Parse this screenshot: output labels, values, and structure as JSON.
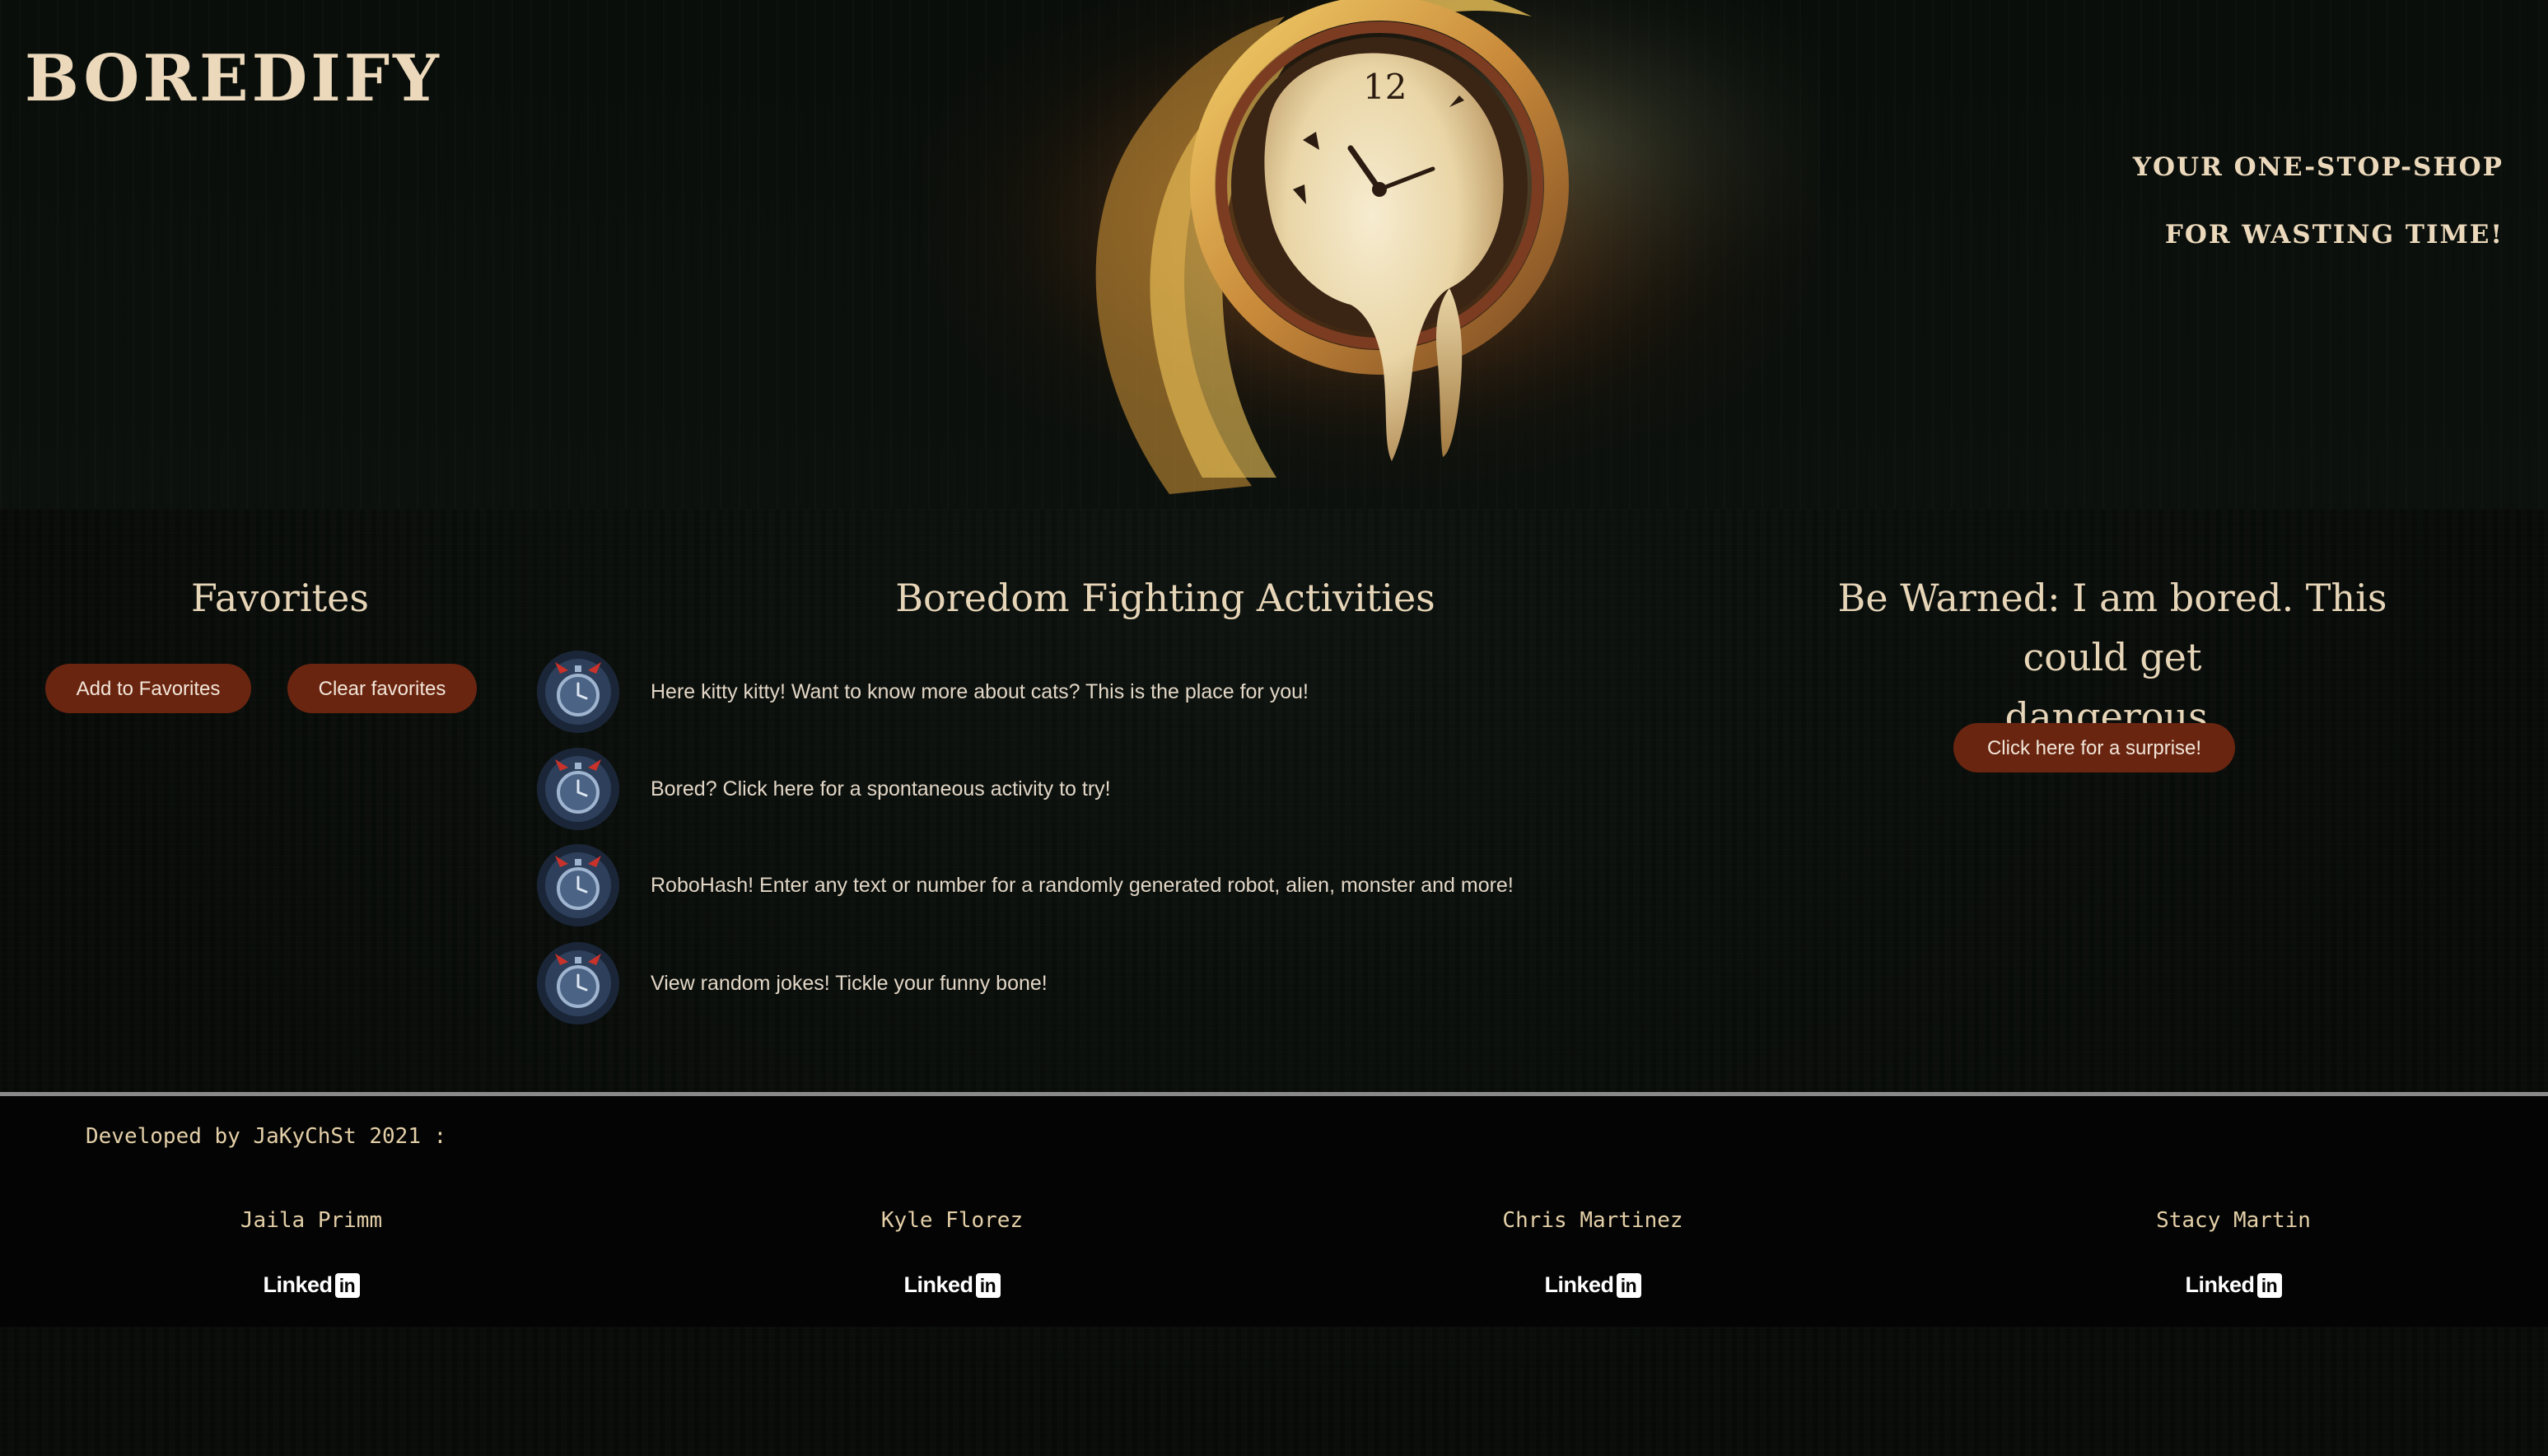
{
  "header": {
    "logo": "Boredify",
    "tagline_line1": "Your one-stop-shop",
    "tagline_line2": "for wasting time!",
    "hero_image": "melting-clock-illustration"
  },
  "favorites": {
    "title": "Favorites",
    "add_label": "Add to Favorites",
    "clear_label": "Clear favorites"
  },
  "activities": {
    "title": "Boredom Fighting Activities",
    "icon": "devil-stopwatch-icon",
    "items": [
      {
        "text": "Here kitty kitty! Want to know more about cats? This is the place for you!"
      },
      {
        "text": "Bored? Click here for a spontaneous activity to try!"
      },
      {
        "text": "RoboHash! Enter any text or number for a randomly generated robot, alien, monster and more!"
      },
      {
        "text": "View random jokes! Tickle your funny bone!"
      }
    ]
  },
  "warning": {
    "title_line1": "Be Warned: I am bored. This could get",
    "title_line2": "dangerous.",
    "surprise_label": "Click here for a surprise!"
  },
  "footer": {
    "developed_by": "Developed by JaKyChSt 2021 :",
    "linkedin_text": "Linked",
    "linkedin_badge": "in",
    "members": [
      {
        "name": "Jaila Primm"
      },
      {
        "name": "Kyle Florez"
      },
      {
        "name": "Chris Martinez"
      },
      {
        "name": "Stacy Martin"
      }
    ]
  },
  "colors": {
    "background": "#070a07",
    "button": "#6a2511",
    "text": "#e7d5b8",
    "footer": "#030403",
    "divider": "#8a8a8a"
  }
}
